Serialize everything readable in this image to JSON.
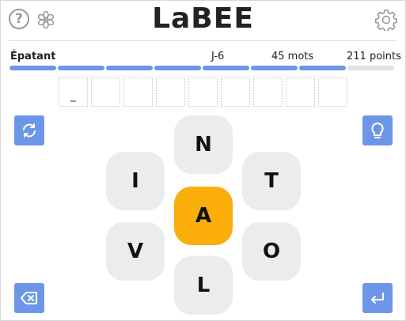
{
  "header": {
    "title": "LaBEE"
  },
  "status": {
    "rank": "Épatant",
    "day": "J-6",
    "words": "45 mots",
    "points": "211 points"
  },
  "progress": {
    "segments_total": 8,
    "segments_filled": 7,
    "filled_color": "#6e96e8",
    "empty_color": "#e2e2e2"
  },
  "word_input": {
    "slots": 9,
    "cursor": "_"
  },
  "letters": {
    "center": "A",
    "top": "N",
    "top_left": "I",
    "top_right": "T",
    "bottom_left": "V",
    "bottom_right": "O",
    "bottom": "L"
  },
  "colors": {
    "accent": "#6e96e8",
    "center_letter": "#fbad0a",
    "outer_letter": "#ececec"
  },
  "icons": {
    "help": "help-icon",
    "flower": "flower-icon",
    "settings": "gear-icon",
    "shuffle": "shuffle-icon",
    "hint": "lightbulb-icon",
    "delete": "backspace-icon",
    "enter": "enter-icon"
  }
}
